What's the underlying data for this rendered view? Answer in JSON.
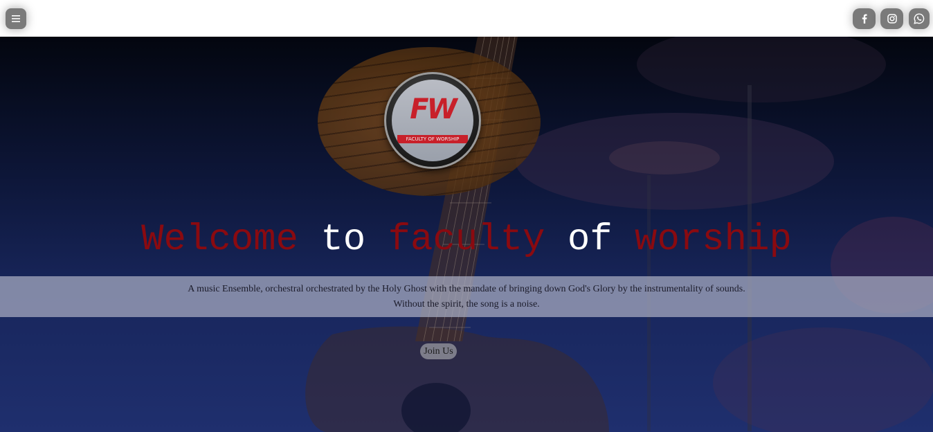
{
  "header": {
    "menu_icon": "hamburger-icon",
    "social": [
      {
        "name": "facebook",
        "icon": "facebook-icon"
      },
      {
        "name": "instagram",
        "icon": "instagram-icon"
      },
      {
        "name": "whatsapp",
        "icon": "whatsapp-icon"
      }
    ]
  },
  "hero": {
    "logo": {
      "mark": "FW",
      "subtitle": "FACULTY OF WORSHIP"
    },
    "title_words": {
      "w1": "Welcome",
      "w2": "to",
      "w3": "faculty",
      "w4": "of",
      "w5": "worship"
    },
    "tagline_line1": "A music Ensemble, orchestral orchestrated by the Holy Ghost with the mandate of bringing down God's Glory by the instrumentality of sounds.",
    "tagline_line2": "Without the spirit, the song is a noise.",
    "cta_label": "Join Us"
  },
  "colors": {
    "accent_red": "#8a0a10",
    "title_white": "#ffffff",
    "topbar": "#ffffff",
    "icon_bg": "#7a7a7a"
  }
}
